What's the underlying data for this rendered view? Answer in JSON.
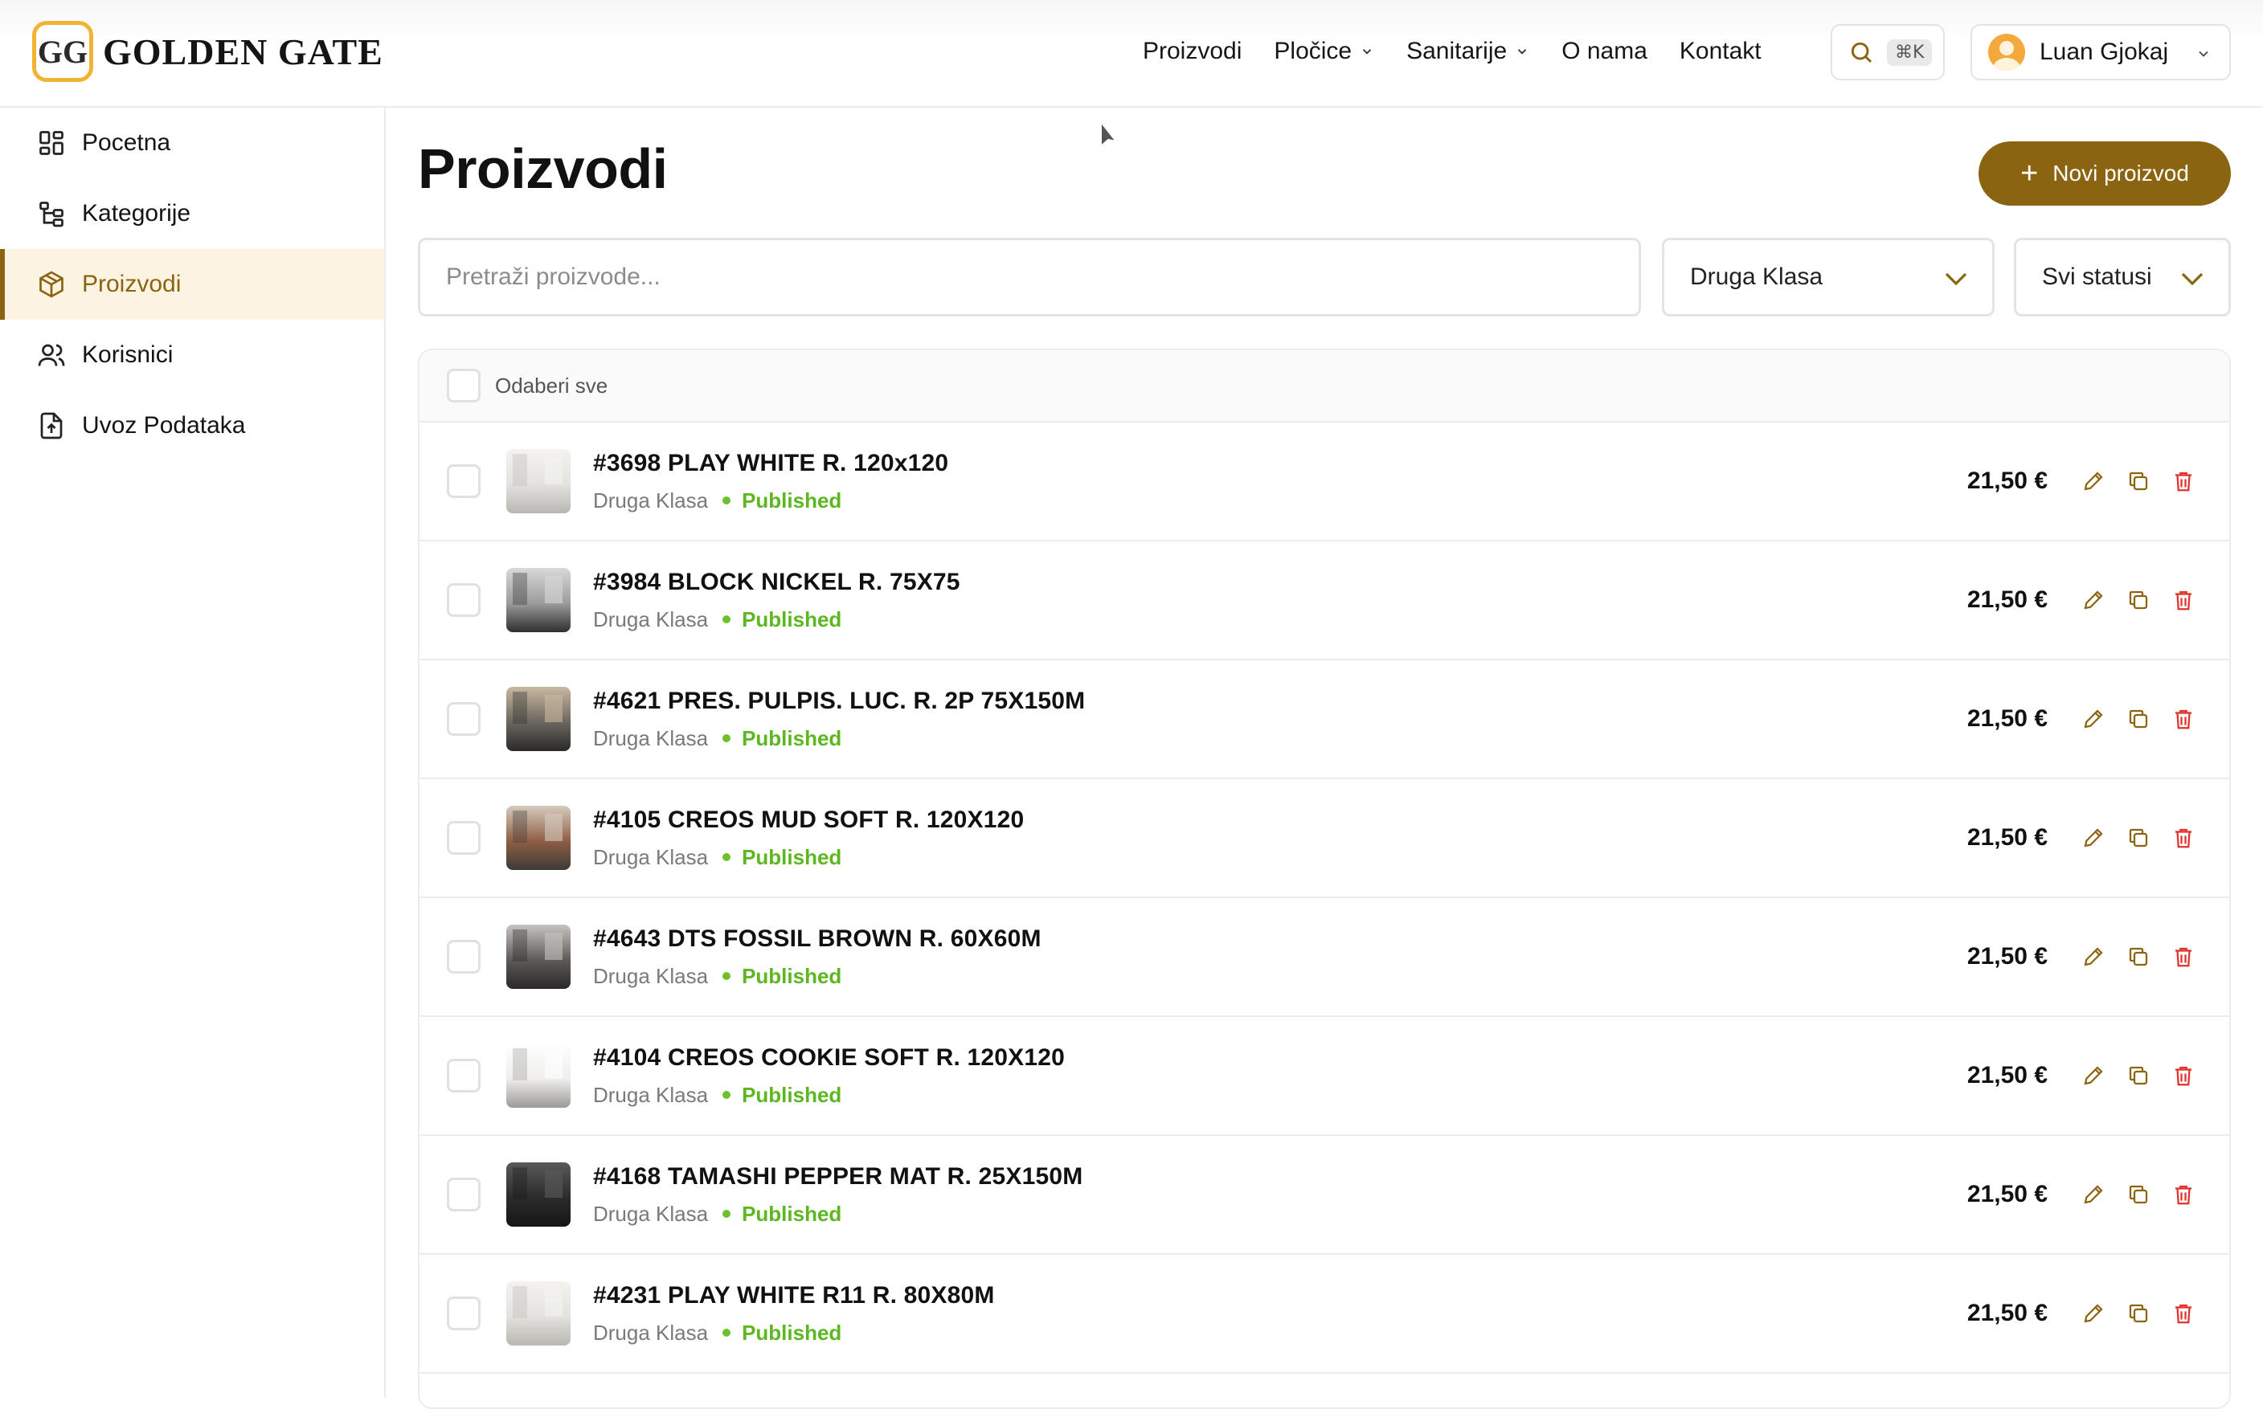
{
  "brand": {
    "logo_mark": "GG",
    "name": "GOLDEN GATE"
  },
  "top_nav": [
    {
      "label": "Proizvodi",
      "dropdown": false
    },
    {
      "label": "Pločice",
      "dropdown": true
    },
    {
      "label": "Sanitarije",
      "dropdown": true
    },
    {
      "label": "O nama",
      "dropdown": false
    },
    {
      "label": "Kontakt",
      "dropdown": false
    }
  ],
  "search_shortcut": "⌘K",
  "user": {
    "name": "Luan Gjokaj"
  },
  "sidebar": {
    "items": [
      {
        "label": "Pocetna",
        "icon": "dashboard-icon",
        "active": false
      },
      {
        "label": "Kategorije",
        "icon": "tree-icon",
        "active": false
      },
      {
        "label": "Proizvodi",
        "icon": "box-icon",
        "active": true
      },
      {
        "label": "Korisnici",
        "icon": "users-icon",
        "active": false
      },
      {
        "label": "Uvoz Podataka",
        "icon": "file-upload-icon",
        "active": false
      }
    ]
  },
  "main": {
    "title": "Proizvodi",
    "new_button": "Novi proizvod",
    "search": {
      "placeholder": "Pretraži proizvode...",
      "value": ""
    },
    "category_filter": "Druga Klasa",
    "status_filter": "Svi statusi",
    "table": {
      "select_all": "Odaberi sve",
      "rows": [
        {
          "title": "#3698 PLAY WHITE R. 120x120",
          "category": "Druga Klasa",
          "status": "Published",
          "price": "21,50 €",
          "thumb": "light"
        },
        {
          "title": "#3984 BLOCK NICKEL R. 75X75",
          "category": "Druga Klasa",
          "status": "Published",
          "price": "21,50 €",
          "thumb": "grey"
        },
        {
          "title": "#4621 PRES. PULPIS. LUC. R. 2P 75X150M",
          "category": "Druga Klasa",
          "status": "Published",
          "price": "21,50 €",
          "thumb": "room"
        },
        {
          "title": "#4105 CREOS MUD SOFT R. 120X120",
          "category": "Druga Klasa",
          "status": "Published",
          "price": "21,50 €",
          "thumb": "warm"
        },
        {
          "title": "#4643 DTS FOSSIL BROWN R. 60X60M",
          "category": "Druga Klasa",
          "status": "Published",
          "price": "21,50 €",
          "thumb": "darkgrey"
        },
        {
          "title": "#4104 CREOS COOKIE SOFT R. 120X120",
          "category": "Druga Klasa",
          "status": "Published",
          "price": "21,50 €",
          "thumb": "bright"
        },
        {
          "title": "#4168 TAMASHI PEPPER MAT R. 25X150M",
          "category": "Druga Klasa",
          "status": "Published",
          "price": "21,50 €",
          "thumb": "dark"
        },
        {
          "title": "#4231 PLAY WHITE R11 R. 80X80M",
          "category": "Druga Klasa",
          "status": "Published",
          "price": "21,50 €",
          "thumb": "light"
        }
      ]
    }
  },
  "colors": {
    "accent": "#8a6410",
    "logo_border": "#f2b233",
    "active_bg": "#fdf3e3",
    "published": "#5cb721",
    "delete": "#e0312b"
  }
}
